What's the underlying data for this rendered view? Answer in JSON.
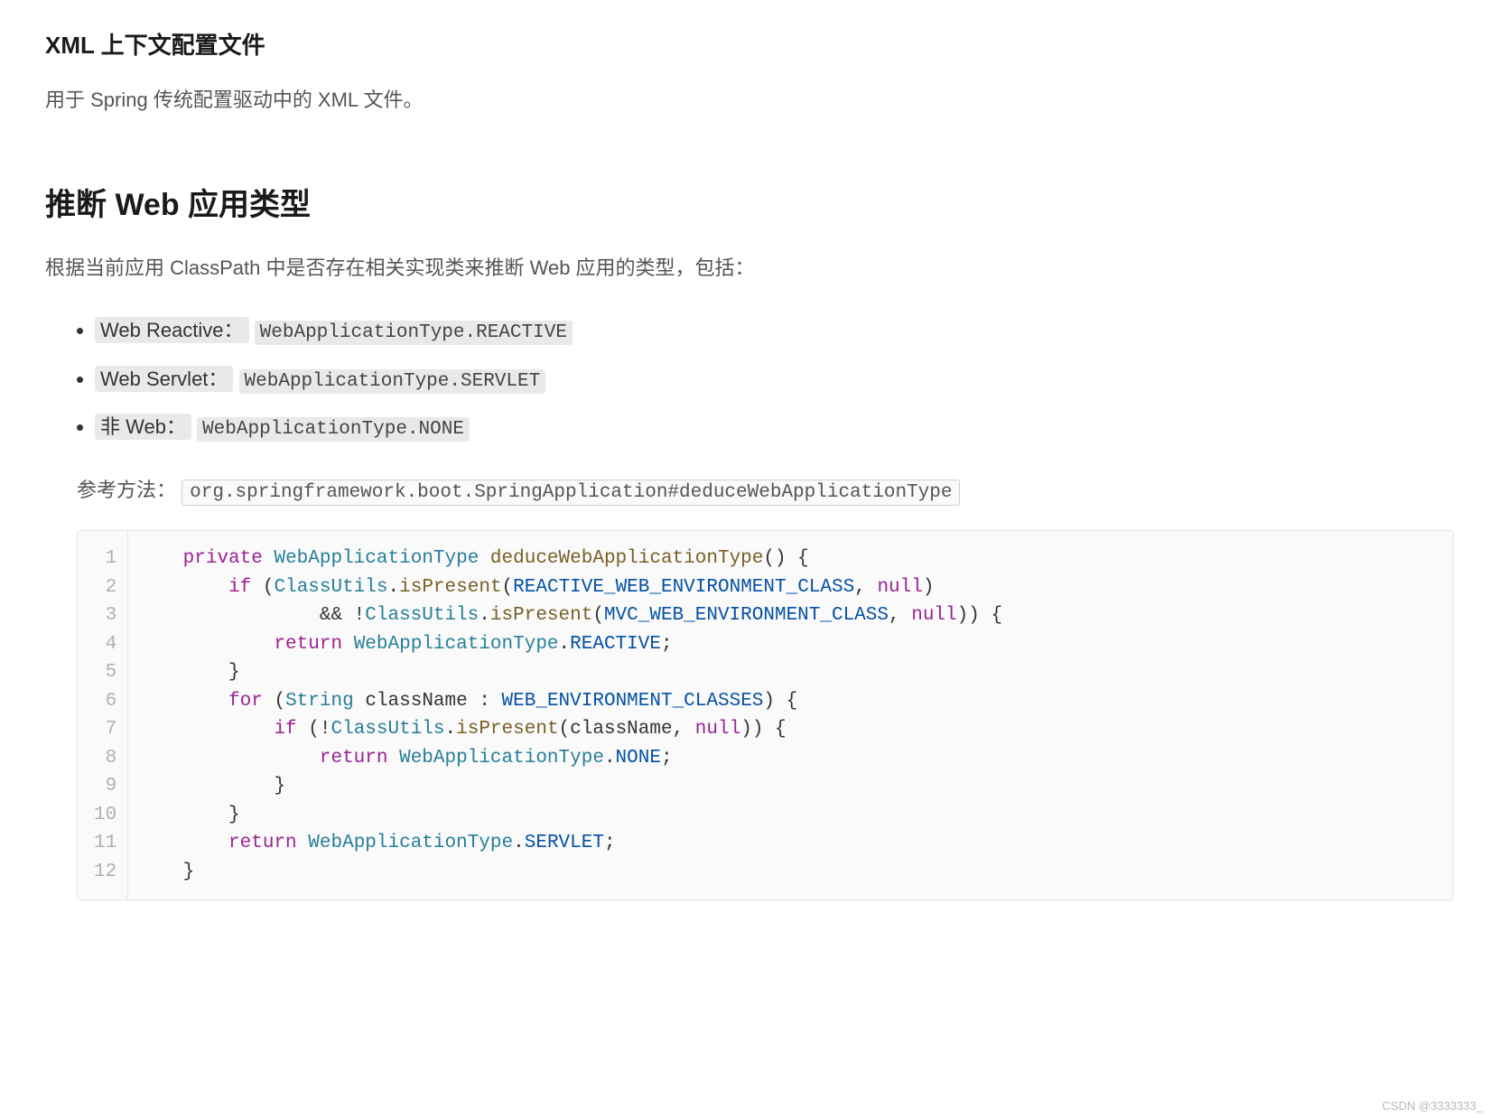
{
  "section1": {
    "title": "XML 上下文配置文件",
    "desc": "用于 Spring 传统配置驱动中的 XML 文件。"
  },
  "section2": {
    "title": "推断 Web 应用类型",
    "desc": "根据当前应用 ClassPath 中是否存在相关实现类来推断 Web 应用的类型，包括：",
    "items": [
      {
        "label": "Web Reactive：",
        "code": "WebApplicationType.REACTIVE"
      },
      {
        "label": "Web Servlet：",
        "code": "WebApplicationType.SERVLET"
      },
      {
        "label": "非 Web：",
        "code": "WebApplicationType.NONE"
      }
    ],
    "ref_label": "参考方法：",
    "ref_value": "org.springframework.boot.SpringApplication#deduceWebApplicationType"
  },
  "code": {
    "line_numbers": [
      "1",
      "2",
      "3",
      "4",
      "5",
      "6",
      "7",
      "8",
      "9",
      "10",
      "11",
      "12"
    ],
    "tokens": {
      "private": "private",
      "WebApplicationType": "WebApplicationType",
      "deduceWebApplicationType": "deduceWebApplicationType",
      "if": "if",
      "ClassUtils": "ClassUtils",
      "isPresent": "isPresent",
      "REACTIVE_WEB_ENVIRONMENT_CLASS": "REACTIVE_WEB_ENVIRONMENT_CLASS",
      "null": "null",
      "MVC_WEB_ENVIRONMENT_CLASS": "MVC_WEB_ENVIRONMENT_CLASS",
      "return": "return",
      "REACTIVE": "REACTIVE",
      "for": "for",
      "String": "String",
      "className": "className",
      "WEB_ENVIRONMENT_CLASSES": "WEB_ENVIRONMENT_CLASSES",
      "NONE": "NONE",
      "SERVLET": "SERVLET"
    }
  },
  "watermark": "CSDN @3333333_"
}
